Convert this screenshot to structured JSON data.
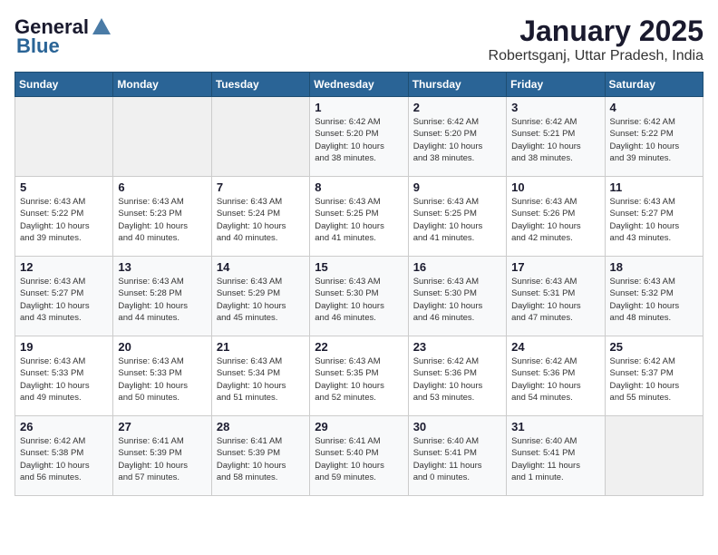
{
  "header": {
    "logo_line1": "General",
    "logo_line2": "Blue",
    "month_title": "January 2025",
    "location": "Robertsganj, Uttar Pradesh, India"
  },
  "weekdays": [
    "Sunday",
    "Monday",
    "Tuesday",
    "Wednesday",
    "Thursday",
    "Friday",
    "Saturday"
  ],
  "weeks": [
    [
      {
        "day": "",
        "info": ""
      },
      {
        "day": "",
        "info": ""
      },
      {
        "day": "",
        "info": ""
      },
      {
        "day": "1",
        "info": "Sunrise: 6:42 AM\nSunset: 5:20 PM\nDaylight: 10 hours\nand 38 minutes."
      },
      {
        "day": "2",
        "info": "Sunrise: 6:42 AM\nSunset: 5:20 PM\nDaylight: 10 hours\nand 38 minutes."
      },
      {
        "day": "3",
        "info": "Sunrise: 6:42 AM\nSunset: 5:21 PM\nDaylight: 10 hours\nand 38 minutes."
      },
      {
        "day": "4",
        "info": "Sunrise: 6:42 AM\nSunset: 5:22 PM\nDaylight: 10 hours\nand 39 minutes."
      }
    ],
    [
      {
        "day": "5",
        "info": "Sunrise: 6:43 AM\nSunset: 5:22 PM\nDaylight: 10 hours\nand 39 minutes."
      },
      {
        "day": "6",
        "info": "Sunrise: 6:43 AM\nSunset: 5:23 PM\nDaylight: 10 hours\nand 40 minutes."
      },
      {
        "day": "7",
        "info": "Sunrise: 6:43 AM\nSunset: 5:24 PM\nDaylight: 10 hours\nand 40 minutes."
      },
      {
        "day": "8",
        "info": "Sunrise: 6:43 AM\nSunset: 5:25 PM\nDaylight: 10 hours\nand 41 minutes."
      },
      {
        "day": "9",
        "info": "Sunrise: 6:43 AM\nSunset: 5:25 PM\nDaylight: 10 hours\nand 41 minutes."
      },
      {
        "day": "10",
        "info": "Sunrise: 6:43 AM\nSunset: 5:26 PM\nDaylight: 10 hours\nand 42 minutes."
      },
      {
        "day": "11",
        "info": "Sunrise: 6:43 AM\nSunset: 5:27 PM\nDaylight: 10 hours\nand 43 minutes."
      }
    ],
    [
      {
        "day": "12",
        "info": "Sunrise: 6:43 AM\nSunset: 5:27 PM\nDaylight: 10 hours\nand 43 minutes."
      },
      {
        "day": "13",
        "info": "Sunrise: 6:43 AM\nSunset: 5:28 PM\nDaylight: 10 hours\nand 44 minutes."
      },
      {
        "day": "14",
        "info": "Sunrise: 6:43 AM\nSunset: 5:29 PM\nDaylight: 10 hours\nand 45 minutes."
      },
      {
        "day": "15",
        "info": "Sunrise: 6:43 AM\nSunset: 5:30 PM\nDaylight: 10 hours\nand 46 minutes."
      },
      {
        "day": "16",
        "info": "Sunrise: 6:43 AM\nSunset: 5:30 PM\nDaylight: 10 hours\nand 46 minutes."
      },
      {
        "day": "17",
        "info": "Sunrise: 6:43 AM\nSunset: 5:31 PM\nDaylight: 10 hours\nand 47 minutes."
      },
      {
        "day": "18",
        "info": "Sunrise: 6:43 AM\nSunset: 5:32 PM\nDaylight: 10 hours\nand 48 minutes."
      }
    ],
    [
      {
        "day": "19",
        "info": "Sunrise: 6:43 AM\nSunset: 5:33 PM\nDaylight: 10 hours\nand 49 minutes."
      },
      {
        "day": "20",
        "info": "Sunrise: 6:43 AM\nSunset: 5:33 PM\nDaylight: 10 hours\nand 50 minutes."
      },
      {
        "day": "21",
        "info": "Sunrise: 6:43 AM\nSunset: 5:34 PM\nDaylight: 10 hours\nand 51 minutes."
      },
      {
        "day": "22",
        "info": "Sunrise: 6:43 AM\nSunset: 5:35 PM\nDaylight: 10 hours\nand 52 minutes."
      },
      {
        "day": "23",
        "info": "Sunrise: 6:42 AM\nSunset: 5:36 PM\nDaylight: 10 hours\nand 53 minutes."
      },
      {
        "day": "24",
        "info": "Sunrise: 6:42 AM\nSunset: 5:36 PM\nDaylight: 10 hours\nand 54 minutes."
      },
      {
        "day": "25",
        "info": "Sunrise: 6:42 AM\nSunset: 5:37 PM\nDaylight: 10 hours\nand 55 minutes."
      }
    ],
    [
      {
        "day": "26",
        "info": "Sunrise: 6:42 AM\nSunset: 5:38 PM\nDaylight: 10 hours\nand 56 minutes."
      },
      {
        "day": "27",
        "info": "Sunrise: 6:41 AM\nSunset: 5:39 PM\nDaylight: 10 hours\nand 57 minutes."
      },
      {
        "day": "28",
        "info": "Sunrise: 6:41 AM\nSunset: 5:39 PM\nDaylight: 10 hours\nand 58 minutes."
      },
      {
        "day": "29",
        "info": "Sunrise: 6:41 AM\nSunset: 5:40 PM\nDaylight: 10 hours\nand 59 minutes."
      },
      {
        "day": "30",
        "info": "Sunrise: 6:40 AM\nSunset: 5:41 PM\nDaylight: 11 hours\nand 0 minutes."
      },
      {
        "day": "31",
        "info": "Sunrise: 6:40 AM\nSunset: 5:41 PM\nDaylight: 11 hours\nand 1 minute."
      },
      {
        "day": "",
        "info": ""
      }
    ]
  ]
}
